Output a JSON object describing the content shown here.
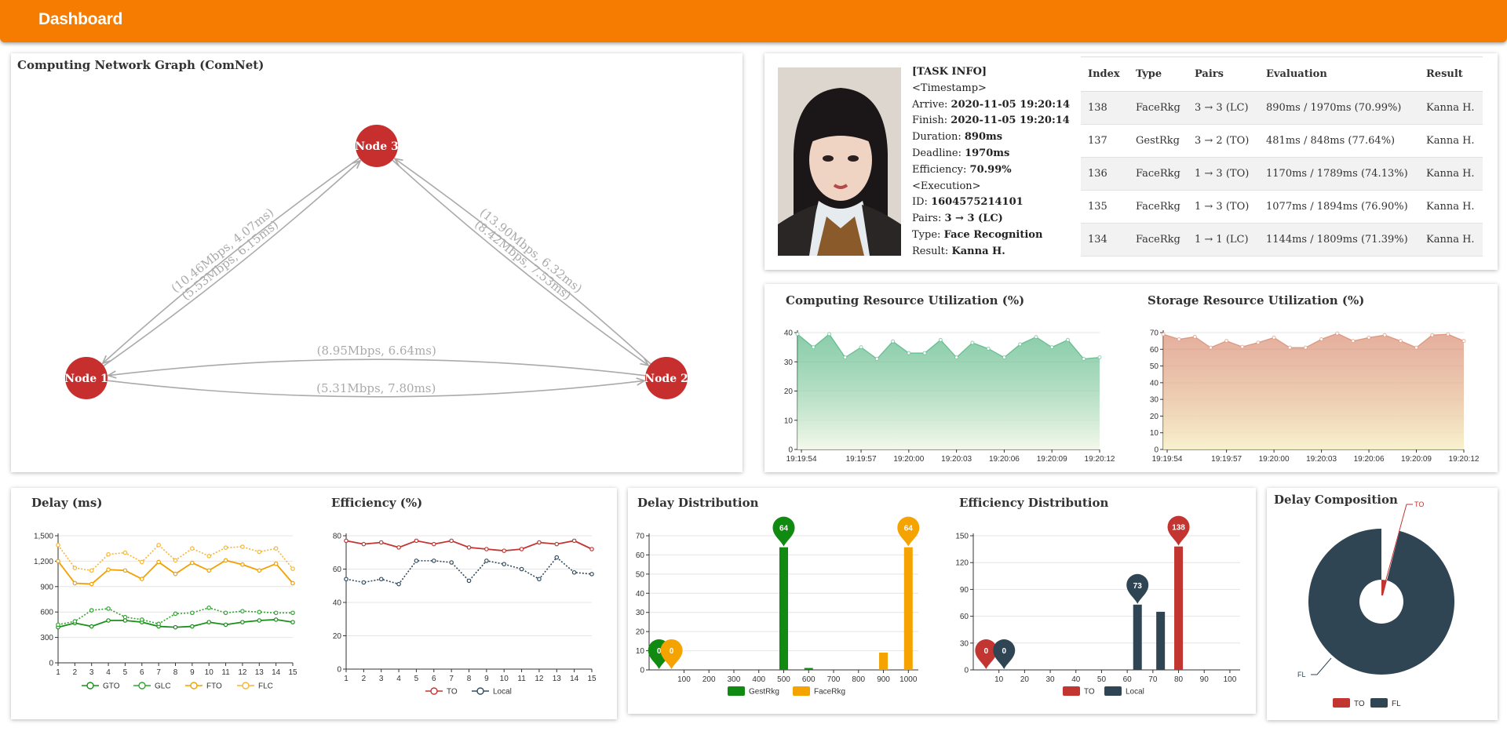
{
  "app": {
    "title": "Dashboard"
  },
  "network": {
    "title": "Computing Network Graph (ComNet)",
    "nodes": [
      {
        "id": "1",
        "label": "Node 1"
      },
      {
        "id": "2",
        "label": "Node 2"
      },
      {
        "id": "3",
        "label": "Node 3"
      }
    ],
    "edges": [
      {
        "from": "1",
        "to": "3",
        "label": "(5.53Mbps, 6.15ms)"
      },
      {
        "from": "3",
        "to": "1",
        "label": "(10.46Mbps, 4.07ms)"
      },
      {
        "from": "3",
        "to": "2",
        "label": "(8.42Mbps, 7.53ms)"
      },
      {
        "from": "2",
        "to": "3",
        "label": "(13.90Mbps, 6.32ms)"
      },
      {
        "from": "1",
        "to": "2",
        "label": "(5.31Mbps, 7.80ms)"
      },
      {
        "from": "2",
        "to": "1",
        "label": "(8.95Mbps, 6.64ms)"
      }
    ],
    "colors": {
      "node": "#c62f2e",
      "edge": "#aaaaaa"
    }
  },
  "task": {
    "heading": "[TASK INFO]",
    "timestamp_heading": "<Timestamp>",
    "arrive_label": "Arrive:",
    "arrive": "2020-11-05 19:20:14",
    "finish_label": "Finish:",
    "finish": "2020-11-05 19:20:14",
    "duration_label": "Duration:",
    "duration": "890ms",
    "deadline_label": "Deadline:",
    "deadline": "1970ms",
    "efficiency_label": "Efficiency:",
    "efficiency": "70.99%",
    "execution_heading": "<Execution>",
    "id_label": "ID:",
    "id": "1604575214101",
    "pairs_label": "Pairs:",
    "pairs": "3 → 3 (LC)",
    "type_label": "Type:",
    "type": "Face Recognition",
    "result_label": "Result:",
    "result": "Kanna H."
  },
  "tasks_table": {
    "headers": [
      "Index",
      "Type",
      "Pairs",
      "Evaluation",
      "Result"
    ],
    "rows": [
      [
        "138",
        "FaceRkg",
        "3 → 3 (LC)",
        "890ms / 1970ms (70.99%)",
        "Kanna H."
      ],
      [
        "137",
        "GestRkg",
        "3 → 2 (TO)",
        "481ms / 848ms (77.64%)",
        "Kanna H."
      ],
      [
        "136",
        "FaceRkg",
        "1 → 3 (TO)",
        "1170ms / 1789ms (74.13%)",
        "Kanna H."
      ],
      [
        "135",
        "FaceRkg",
        "1 → 3 (TO)",
        "1077ms / 1894ms (76.90%)",
        "Kanna H."
      ],
      [
        "134",
        "FaceRkg",
        "1 → 1 (LC)",
        "1144ms / 1809ms (71.39%)",
        "Kanna H."
      ]
    ]
  },
  "chart_data": [
    {
      "id": "computing",
      "type": "area",
      "title": "Computing Resource Utilization (%)",
      "x_ticks": [
        "19:19:54",
        "19:19:57",
        "19:20:00",
        "19:20:03",
        "19:20:06",
        "19:20:09",
        "19:20:12"
      ],
      "ylim": [
        0,
        40
      ],
      "y_ticks": [
        0,
        10,
        20,
        30,
        40
      ],
      "values": [
        39.5,
        35,
        39.5,
        31.5,
        35,
        31,
        37,
        33,
        33,
        37.5,
        31.5,
        36.5,
        34.5,
        31.5,
        36,
        38.5,
        35,
        37.5,
        31,
        31.5
      ],
      "color": "#4db37e"
    },
    {
      "id": "storage",
      "type": "area",
      "title": "Storage Resource Utilization (%)",
      "x_ticks": [
        "19:19:54",
        "19:19:57",
        "19:20:00",
        "19:20:03",
        "19:20:06",
        "19:20:09",
        "19:20:12"
      ],
      "ylim": [
        0,
        70
      ],
      "y_ticks": [
        0,
        10,
        20,
        30,
        40,
        50,
        60,
        70
      ],
      "values": [
        69,
        66,
        67.5,
        61,
        65,
        61.5,
        64,
        67,
        61,
        61,
        66,
        69.5,
        65,
        67,
        68.5,
        65,
        61,
        68.5,
        69,
        65
      ],
      "color": "#d7856a"
    },
    {
      "id": "delay",
      "type": "line",
      "title": "Delay (ms)",
      "x": [
        1,
        2,
        3,
        4,
        5,
        6,
        7,
        8,
        9,
        10,
        11,
        12,
        13,
        14,
        15
      ],
      "ylim": [
        0,
        1500
      ],
      "y_ticks": [
        0,
        300,
        600,
        900,
        "1,200",
        "1,500"
      ],
      "series": [
        {
          "name": "GTO",
          "color": "#1a8f1a",
          "dashed": false,
          "values": [
            420,
            470,
            430,
            500,
            500,
            480,
            430,
            420,
            430,
            480,
            450,
            480,
            500,
            510,
            480
          ]
        },
        {
          "name": "GLC",
          "color": "#2fa52f",
          "dashed": true,
          "values": [
            450,
            490,
            620,
            640,
            540,
            510,
            460,
            580,
            590,
            650,
            590,
            610,
            600,
            590,
            590
          ]
        },
        {
          "name": "FTO",
          "color": "#f2a100",
          "dashed": false,
          "values": [
            1200,
            940,
            930,
            1100,
            1090,
            990,
            1190,
            1050,
            1180,
            1090,
            1210,
            1160,
            1090,
            1170,
            940
          ]
        },
        {
          "name": "FLC",
          "color": "#f6b531",
          "dashed": true,
          "values": [
            1390,
            1120,
            1090,
            1280,
            1300,
            1190,
            1390,
            1210,
            1350,
            1260,
            1360,
            1370,
            1310,
            1350,
            1110
          ]
        }
      ]
    },
    {
      "id": "efficiency",
      "type": "line",
      "title": "Efficiency (%)",
      "x": [
        1,
        2,
        3,
        4,
        5,
        6,
        7,
        8,
        9,
        10,
        11,
        12,
        13,
        14,
        15
      ],
      "ylim": [
        0,
        80
      ],
      "y_ticks": [
        0,
        20,
        40,
        60,
        80
      ],
      "series": [
        {
          "name": "TO",
          "color": "#c23531",
          "dashed": false,
          "values": [
            77,
            75,
            76,
            73,
            77,
            75,
            77,
            73,
            72,
            71,
            72,
            76,
            75,
            77,
            72
          ]
        },
        {
          "name": "Local",
          "color": "#334b5c",
          "dashed": true,
          "values": [
            54,
            52,
            54,
            51,
            65,
            65,
            64,
            53,
            65,
            63,
            60,
            54,
            67,
            58,
            57
          ]
        }
      ]
    },
    {
      "id": "delay_dist",
      "type": "bar",
      "title": "Delay Distribution",
      "x_ticks": [
        100,
        200,
        300,
        400,
        500,
        600,
        700,
        800,
        900,
        1000
      ],
      "ylim": [
        0,
        70
      ],
      "y_ticks": [
        0,
        10,
        20,
        30,
        40,
        50,
        60,
        70
      ],
      "series": [
        {
          "name": "GestRkg",
          "color": "#108a10",
          "points": [
            [
              500,
              64
            ],
            [
              600,
              1
            ]
          ]
        },
        {
          "name": "FaceRkg",
          "color": "#f5a300",
          "points": [
            [
              900,
              9
            ],
            [
              1000,
              64
            ]
          ]
        }
      ],
      "markers": [
        {
          "x": 0,
          "value": "0",
          "color": "#108a10"
        },
        {
          "x": 50,
          "value": "0",
          "color": "#f5a300"
        },
        {
          "x": 500,
          "value": "64",
          "color": "#108a10"
        },
        {
          "x": 1000,
          "value": "64",
          "color": "#f5a300"
        }
      ]
    },
    {
      "id": "eff_dist",
      "type": "bar",
      "title": "Efficiency Distribution",
      "x_ticks": [
        10,
        20,
        30,
        40,
        50,
        60,
        70,
        80,
        90,
        100
      ],
      "ylim": [
        0,
        150
      ],
      "y_ticks": [
        0,
        30,
        60,
        90,
        120,
        150
      ],
      "series": [
        {
          "name": "TO",
          "color": "#c23531",
          "points": [
            [
              80,
              138
            ]
          ]
        },
        {
          "name": "Local",
          "color": "#2f4554",
          "points": [
            [
              64,
              73
            ],
            [
              73,
              65
            ]
          ]
        }
      ],
      "markers": [
        {
          "x": 5,
          "value": "0",
          "color": "#c23531"
        },
        {
          "x": 12,
          "value": "0",
          "color": "#2f4554"
        },
        {
          "x": 64,
          "value": "73",
          "color": "#2f4554"
        },
        {
          "x": 80,
          "value": "138",
          "color": "#c23531"
        }
      ]
    },
    {
      "id": "delay_comp",
      "type": "pie",
      "title": "Delay Composition",
      "slices": [
        {
          "name": "TO",
          "value": 4,
          "color": "#c23531"
        },
        {
          "name": "FL",
          "value": 96,
          "color": "#2f4554"
        }
      ]
    }
  ]
}
